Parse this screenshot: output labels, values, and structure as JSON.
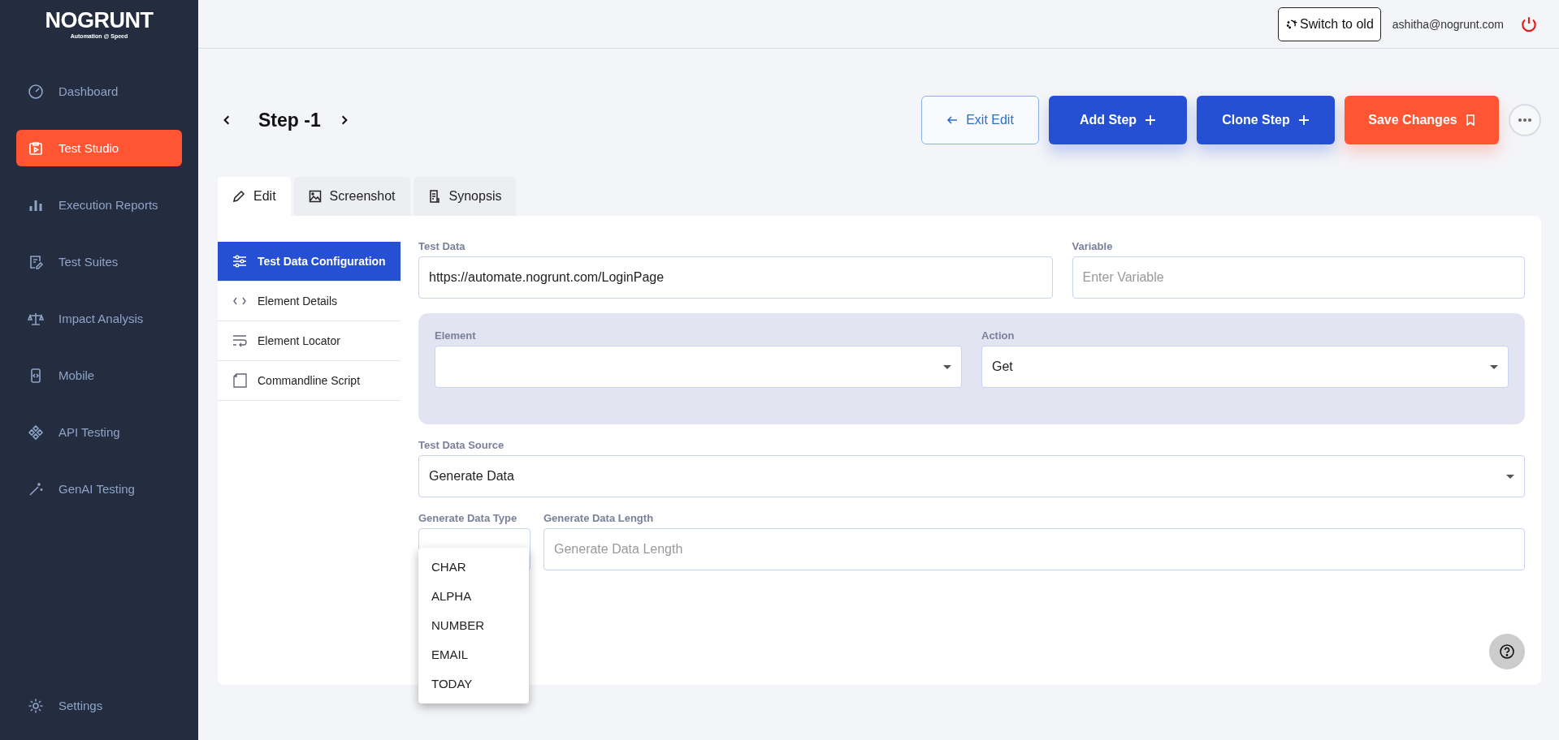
{
  "logo": {
    "name": "NOGRUNT",
    "tagline": "Automation @ Speed"
  },
  "sidebar": {
    "items": [
      {
        "label": "Dashboard",
        "selected": false
      },
      {
        "label": "Test Studio",
        "selected": true
      },
      {
        "label": "Execution Reports",
        "selected": false
      },
      {
        "label": "Test Suites",
        "selected": false
      },
      {
        "label": "Impact Analysis",
        "selected": false
      },
      {
        "label": "Mobile",
        "selected": false
      },
      {
        "label": "API Testing",
        "selected": false
      },
      {
        "label": "GenAI Testing",
        "selected": false
      }
    ],
    "settings": "Settings"
  },
  "header": {
    "switch_button": "Switch to old",
    "user_email": "ashitha@nogrunt.com"
  },
  "step": {
    "title": "Step -1"
  },
  "actions": [
    {
      "label": "Exit Edit",
      "kind": "outline"
    },
    {
      "label": "Add Step",
      "kind": "primary"
    },
    {
      "label": "Clone Step",
      "kind": "primary"
    },
    {
      "label": "Save Changes",
      "kind": "accent"
    }
  ],
  "tabs": [
    {
      "label": "Edit",
      "selected": true
    },
    {
      "label": "Screenshot",
      "selected": false
    },
    {
      "label": "Synopsis",
      "selected": false
    }
  ],
  "config_menu": [
    {
      "label": "Test Data Configuration",
      "selected": true
    },
    {
      "label": "Element Details",
      "selected": false
    },
    {
      "label": "Element Locator",
      "selected": false
    },
    {
      "label": "Commandline Script",
      "selected": false
    }
  ],
  "form": {
    "test_data": {
      "label": "Test Data",
      "value": "https://automate.nogrunt.com/LoginPage"
    },
    "variable": {
      "label": "Variable",
      "placeholder": "Enter Variable"
    },
    "element": {
      "label": "Element"
    },
    "action": {
      "label": "Action",
      "value": "Get"
    },
    "source": {
      "label": "Test Data Source",
      "value": "Generate Data"
    },
    "gen_type": {
      "label": "Generate Data Type",
      "expanded": true,
      "options": [
        "CHAR",
        "ALPHA",
        "NUMBER",
        "EMAIL",
        "TODAY"
      ]
    },
    "gen_length": {
      "label": "Generate Data Length",
      "placeholder": "Generate Data Length"
    }
  }
}
